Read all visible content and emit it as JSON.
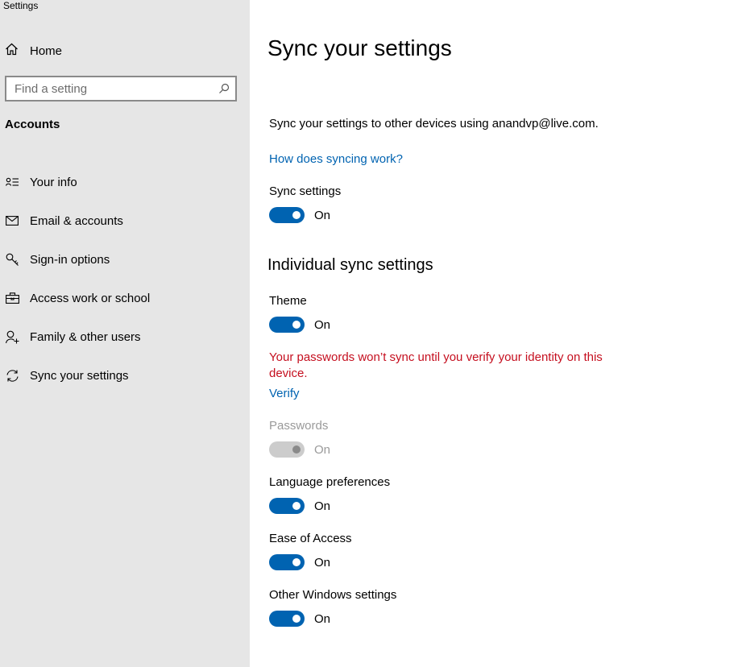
{
  "app": {
    "title": "Settings"
  },
  "sidebar": {
    "home_label": "Home",
    "search_placeholder": "Find a setting",
    "section_title": "Accounts",
    "items": [
      {
        "label": "Your info",
        "icon": "contact-card-icon"
      },
      {
        "label": "Email & accounts",
        "icon": "mail-icon"
      },
      {
        "label": "Sign-in options",
        "icon": "key-icon"
      },
      {
        "label": "Access work or school",
        "icon": "briefcase-icon"
      },
      {
        "label": "Family & other users",
        "icon": "add-user-icon"
      },
      {
        "label": "Sync your settings",
        "icon": "sync-icon"
      }
    ]
  },
  "main": {
    "title": "Sync your settings",
    "description": "Sync your settings to other devices using anandvp@live.com.",
    "help_link": "How does syncing work?",
    "sync_settings": {
      "label": "Sync settings",
      "state": "On",
      "on": true
    },
    "individual_heading": "Individual sync settings",
    "theme": {
      "label": "Theme",
      "state": "On",
      "on": true
    },
    "warning": "Your passwords won’t sync until you verify your identity on this device.",
    "verify_link": "Verify",
    "passwords": {
      "label": "Passwords",
      "state": "On",
      "disabled": true
    },
    "language": {
      "label": "Language preferences",
      "state": "On",
      "on": true
    },
    "ease": {
      "label": "Ease of Access",
      "state": "On",
      "on": true
    },
    "other": {
      "label": "Other Windows settings",
      "state": "On",
      "on": true
    }
  },
  "colors": {
    "accent": "#0063b1",
    "warning": "#c50f1f",
    "sidebar_bg": "#e6e6e6"
  }
}
